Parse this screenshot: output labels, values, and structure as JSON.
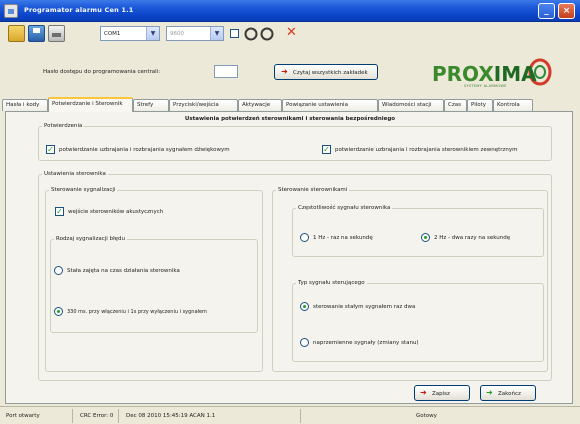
{
  "window": {
    "title": "Programator alarmu Cen 1.1",
    "min_glyph": "_",
    "close_glyph": "×"
  },
  "toolbar": {
    "port": "COM1",
    "baud": "9600",
    "connect_icon": "connection-rings-icon",
    "disconnect_glyph": "✕"
  },
  "header": {
    "password_label": "Hasło dostępu do programowania centrali:",
    "password_value": "",
    "read_all_label": "Czytaj wszystkich zakładek",
    "logo_prefix": "PROX",
    "logo_suffix": "IMA",
    "logo_sub": "SYSTEMY ALARMOWE"
  },
  "tabs": [
    {
      "label": "Hasła i kody"
    },
    {
      "label": "Potwierdzanie i Sterownik"
    },
    {
      "label": "Strefy"
    },
    {
      "label": "Przyciski/wejścia"
    },
    {
      "label": "Aktywacje"
    },
    {
      "label": "Powiązanie ustawienia"
    },
    {
      "label": "Wiadomości stacji"
    },
    {
      "label": "Czas"
    },
    {
      "label": "Piloty"
    },
    {
      "label": "Kontrola"
    }
  ],
  "panel": {
    "title": "Ustawienia potwierdzeń sterownikami i sterowania bezpośredniego",
    "confirm_group": {
      "legend": "Potwierdzenia",
      "option1": "potwierdzanie uzbrajania i rozbrajania sygnałem dźwiękowym",
      "option2": "potwierdzanie uzbrajania i rozbrajania sterownikiem zewnętrznym"
    },
    "settings_group": {
      "legend": "Ustawienia sterownika",
      "signal_group": {
        "legend": "Sterowanie sygnalizacji",
        "enable_label": "wejście sterowników akustycznych",
        "type_group": {
          "legend": "Rodzaj sygnalizacji błędu",
          "option1": "Stała zajęta na czas działania sterownika",
          "option2": "330 ms. przy włączeniu i 1s przy wyłączeniu i sygnałem"
        }
      },
      "control_group": {
        "legend": "Sterowanie sterownikami",
        "freq_group": {
          "legend": "Częstotliwość sygnału sterownika",
          "option1": "1 Hz - raz na sekundę",
          "option2": "2 Hz - dwa razy na sekundę"
        },
        "signal_type_group": {
          "legend": "Typ sygnału sterującego",
          "option1": "sterowanie stałym sygnałem raz dwa",
          "option2": "naprzemienne sygnały (zmiany stanu)"
        }
      }
    }
  },
  "buttons": {
    "write": "Zapisz",
    "exit": "Zakończ"
  },
  "statusbar": {
    "port": "Port otwarty",
    "crc": "CRC Error: 0",
    "datetime": "Dec 08 2010  15:45:19  ACAN 1.1",
    "status": "Gotowy"
  },
  "colors": {
    "title_bar": "#1d59d9",
    "accent_check": "#21a121",
    "read_arrow": "#c81a12",
    "logo_green": "#3a8a2c"
  },
  "state": {
    "confirm_sound_checked": true,
    "confirm_external_checked": true,
    "signal_enabled_checked": true,
    "confirm_type_selected": 2,
    "freq_selected": 2,
    "signal_type_selected": 1
  }
}
